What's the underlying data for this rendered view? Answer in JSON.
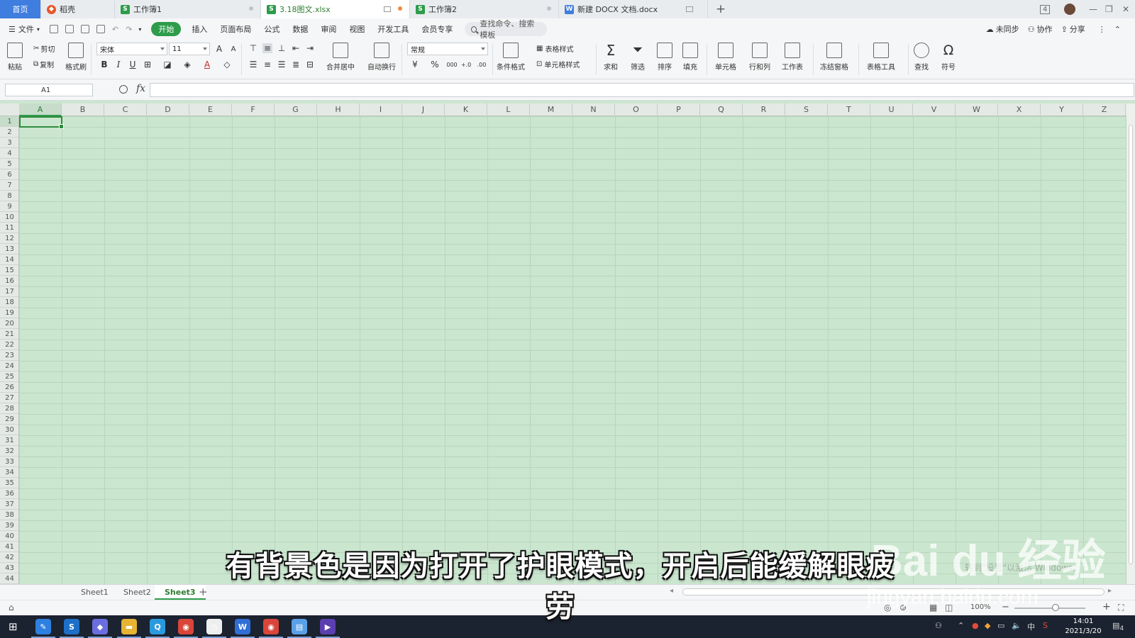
{
  "tabs": [
    {
      "label": "首页",
      "kind": "home"
    },
    {
      "label": "稻壳",
      "kind": "docer"
    },
    {
      "label": "工作簿1",
      "kind": "sheet"
    },
    {
      "label": "3.18图文.xlsx",
      "kind": "sheet",
      "active": true
    },
    {
      "label": "工作簿2",
      "kind": "sheet"
    },
    {
      "label": "新建 DOCX 文档.docx",
      "kind": "word"
    }
  ],
  "tabbar": {
    "new_tab": "+",
    "badge": "4",
    "minimize": "—",
    "restore": "❐",
    "close": "✕"
  },
  "menu": {
    "file": "文件",
    "items": [
      "开始",
      "插入",
      "页面布局",
      "公式",
      "数据",
      "审阅",
      "视图",
      "开发工具",
      "会员专享"
    ],
    "active": "开始",
    "search_placeholder": "查找命令、搜索模板",
    "sync": "未同步",
    "collab": "协作",
    "share": "分享"
  },
  "ribbon": {
    "paste": "粘贴",
    "cut": "剪切",
    "copy": "复制",
    "format_painter": "格式刷",
    "font_name": "宋体",
    "font_size": "11",
    "merge_center": "合并居中",
    "wrap_text": "自动换行",
    "number_format": "常规",
    "currency": "¥",
    "percent": "%",
    "thousands": "000",
    "cond_format": "条件格式",
    "table_style": "表格样式",
    "cell_style": "单元格样式",
    "sum": "求和",
    "filter": "筛选",
    "sort": "排序",
    "fill": "填充",
    "cells": "单元格",
    "rows_cols": "行和列",
    "worksheet": "工作表",
    "freeze": "冻结窗格",
    "table_tools": "表格工具",
    "find": "查找",
    "symbol": "符号"
  },
  "formula_bar": {
    "name_box": "A1",
    "fx": "fx",
    "value": ""
  },
  "grid": {
    "columns": [
      "A",
      "B",
      "C",
      "D",
      "E",
      "F",
      "G",
      "H",
      "I",
      "J",
      "K",
      "L",
      "M",
      "N",
      "O",
      "P",
      "Q",
      "R",
      "S",
      "T",
      "U",
      "V",
      "W",
      "X",
      "Y",
      "Z"
    ],
    "rows": [
      "1",
      "2",
      "3",
      "4",
      "5",
      "6",
      "7",
      "8",
      "9",
      "10",
      "11",
      "12",
      "13",
      "14",
      "15",
      "16",
      "17",
      "18",
      "19",
      "20",
      "21",
      "22",
      "23",
      "24",
      "25",
      "26",
      "27",
      "28",
      "29",
      "30",
      "31",
      "32",
      "33",
      "34",
      "35",
      "36",
      "37",
      "38",
      "39",
      "40",
      "41",
      "42",
      "43",
      "44"
    ],
    "selected_cell": "A1",
    "background_color": "#cbe6cf"
  },
  "sheets": [
    "Sheet1",
    "Sheet2",
    "Sheet3"
  ],
  "active_sheet": "Sheet3",
  "statusbar": {
    "zoom": "100%"
  },
  "taskbar": {
    "apps": [
      {
        "icon": "feather-icon",
        "color": "#2d7fe0",
        "glyph": "✎"
      },
      {
        "icon": "s-app-icon",
        "color": "#1e6fc8",
        "glyph": "S"
      },
      {
        "icon": "cube-icon",
        "color": "#6a6ee0",
        "glyph": "◆"
      },
      {
        "icon": "folder-icon",
        "color": "#e6b332",
        "glyph": "▬"
      },
      {
        "icon": "q-app-icon",
        "color": "#2a9adf",
        "glyph": "Q"
      },
      {
        "icon": "chrome-icon",
        "color": "#d9453a",
        "glyph": "◉"
      },
      {
        "icon": "clock-app-icon",
        "color": "#eeeeee",
        "glyph": "◷"
      },
      {
        "icon": "word-icon",
        "color": "#2f6fd6",
        "glyph": "W"
      },
      {
        "icon": "chrome-icon-2",
        "color": "#d9453a",
        "glyph": "◉"
      },
      {
        "icon": "note-icon",
        "color": "#5aa0e8",
        "glyph": "▤"
      },
      {
        "icon": "media-icon",
        "color": "#5b3fb0",
        "glyph": "▶"
      }
    ],
    "tray_ime": "中",
    "time": "14:01",
    "date": "2021/3/20",
    "notifications": "4"
  },
  "overlay": {
    "subtitle": "有背景色是因为打开了护眼模式，开启后能缓解眼疲劳",
    "watermark_brand": "Bai du 经验",
    "watermark_url": "jingyan.baidu.com",
    "activate_text": "转到\"设置\"以激活 Windows。"
  }
}
